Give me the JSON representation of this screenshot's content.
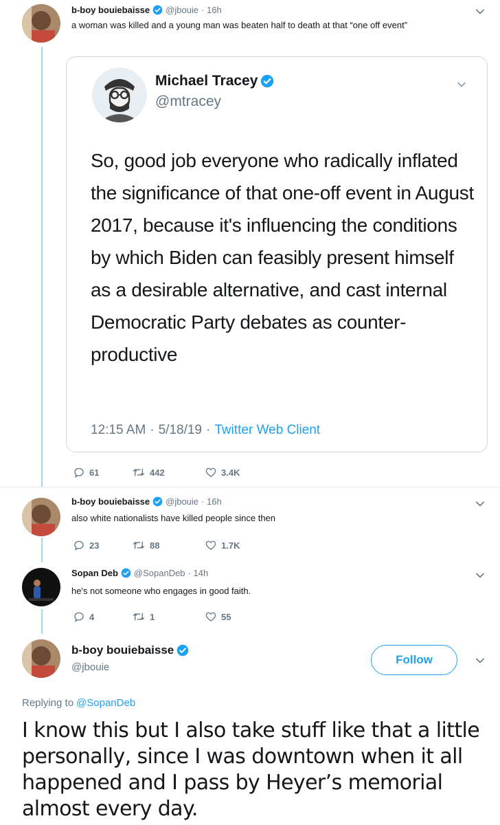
{
  "colors": {
    "accent": "#1da1f2",
    "text": "#14171a",
    "muted": "#657786",
    "thread": "#9dd7f0",
    "border": "#ccd6dd"
  },
  "tweet1": {
    "name": "b-boy bouiebaisse",
    "handle": "@jbouie",
    "time": "· 16h",
    "text": "a woman was killed and a young man was beaten half to death at that “one off event”",
    "quoted": {
      "name": "Michael Tracey",
      "handle": "@mtracey",
      "text": "So, good job everyone who radically inflated the significance of that one-off event in August 2017, because it's influencing the conditions by which Biden can feasibly present himself as a desirable alternative, and cast internal Democratic Party debates as counter-productive",
      "time": "12:15 AM",
      "date": "5/18/19",
      "client": "Twitter Web Client",
      "sep": "·"
    },
    "replies": "61",
    "retweets": "442",
    "likes": "3.4K"
  },
  "tweet2": {
    "name": "b-boy bouiebaisse",
    "handle": "@jbouie",
    "time": "· 16h",
    "text": "also white nationalists have killed people since then",
    "replies": "23",
    "retweets": "88",
    "likes": "1.7K"
  },
  "tweet3": {
    "name": "Sopan Deb",
    "handle": "@SopanDeb",
    "time": "· 14h",
    "text": "he's not someone who engages in good faith.",
    "replies": "4",
    "retweets": "1",
    "likes": "55"
  },
  "main": {
    "name": "b-boy bouiebaisse",
    "handle": "@jbouie",
    "follow_label": "Follow",
    "replying_prefix": "Replying to",
    "replying_to": "@SopanDeb",
    "text": "I know this but I also take stuff like that a little personally, since I was downtown when it all happened and I pass by Heyer’s memorial almost every day."
  }
}
